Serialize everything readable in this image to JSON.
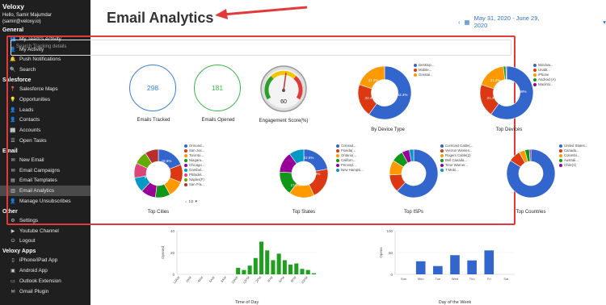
{
  "sidebar": {
    "brand": "Veloxy",
    "greeting": "Hello, Samir Majumdar",
    "email": "(samir@veloxy.io)",
    "sections": [
      {
        "title": "General",
        "items": [
          {
            "label": "My Team's Activity",
            "icon": "team-icon",
            "glyph": "👥"
          },
          {
            "label": "My Activity",
            "icon": "user-icon",
            "glyph": "👤"
          },
          {
            "label": "Push Notifications",
            "icon": "bell-icon",
            "glyph": "🔔"
          },
          {
            "label": "Search",
            "icon": "search-icon",
            "glyph": "🔍"
          }
        ]
      },
      {
        "title": "Salesforce",
        "items": [
          {
            "label": "Salesforce Maps",
            "icon": "map-pin-icon",
            "glyph": "📍"
          },
          {
            "label": "Opportunities",
            "icon": "lightbulb-icon",
            "glyph": "💡"
          },
          {
            "label": "Leads",
            "icon": "user-icon",
            "glyph": "👤"
          },
          {
            "label": "Contacts",
            "icon": "contact-icon",
            "glyph": "👤"
          },
          {
            "label": "Accounts",
            "icon": "building-icon",
            "glyph": "🏢"
          },
          {
            "label": "Open Tasks",
            "icon": "list-icon",
            "glyph": "☰"
          }
        ]
      },
      {
        "title": "Email",
        "items": [
          {
            "label": "New Email",
            "icon": "envelope-icon",
            "glyph": "✉"
          },
          {
            "label": "Email Campaigns",
            "icon": "envelope-icon",
            "glyph": "✉"
          },
          {
            "label": "Email Templates",
            "icon": "template-icon",
            "glyph": "▤"
          },
          {
            "label": "Email Analytics",
            "icon": "bar-chart-icon",
            "glyph": "▥",
            "active": true
          },
          {
            "label": "Manage Unsubscribes",
            "icon": "user-minus-icon",
            "glyph": "👤"
          }
        ]
      },
      {
        "title": "Other",
        "items": [
          {
            "label": "Settings",
            "icon": "gear-icon",
            "glyph": "⚙"
          },
          {
            "label": "Youtube Channel",
            "icon": "video-icon",
            "glyph": "▶"
          },
          {
            "label": "Logout",
            "icon": "logout-icon",
            "glyph": "⏻"
          }
        ]
      },
      {
        "title": "Veloxy Apps",
        "items": [
          {
            "label": "iPhone/iPad App",
            "icon": "phone-icon",
            "glyph": "▯"
          },
          {
            "label": "Android App",
            "icon": "android-icon",
            "glyph": "▣"
          },
          {
            "label": "Outlook Extension",
            "icon": "monitor-icon",
            "glyph": "▭"
          },
          {
            "label": "Gmail Plugin",
            "icon": "gmail-icon",
            "glyph": "✉"
          }
        ]
      }
    ]
  },
  "header": {
    "title": "Email Analytics",
    "date_range": "May 31, 2020 - June 29, 2020"
  },
  "search": {
    "placeholder": "Search Tracking details"
  },
  "metrics": {
    "tracked": {
      "value": "298",
      "label": "Emails Tracked"
    },
    "opened": {
      "value": "181",
      "label": "Emails Opened"
    },
    "engagement": {
      "value": "60",
      "label": "Engagement Score(%)"
    }
  },
  "colors": {
    "blue": "#3366cc",
    "red": "#dc3912",
    "orange": "#ff9900",
    "green": "#109618",
    "purple": "#990099",
    "cyan": "#0099c6",
    "pink": "#dd4477",
    "lime": "#66aa00",
    "darkred": "#b82e2e",
    "navy": "#316395"
  },
  "charts_row1": [
    {
      "caption": "By Device Type",
      "legend": [
        "Desktop...",
        "Mobile...",
        "Greatai..."
      ],
      "labels": [
        "62.4%",
        "22.4%",
        "21.2%"
      ]
    },
    {
      "caption": "Top Devices",
      "legend": [
        "Window...",
        "Unabl...",
        "iPhone",
        "Android (A)",
        "Macinto..."
      ],
      "labels": [
        "69%",
        "21.3%",
        "21.2%"
      ]
    }
  ],
  "charts_row2": [
    {
      "caption": "Top Cities",
      "legend": [
        "Ormond...",
        "San Jos...",
        "Toronto...",
        "Niagara...",
        "Chicago...",
        "Gambel...",
        "Philadel...",
        "Naples(F)",
        "San Fra..."
      ],
      "labels": [
        "18.6%",
        "8%"
      ],
      "pager": "1/2"
    },
    {
      "caption": "Top States",
      "legend": [
        "Colorad...",
        "Florida(...",
        "Ontario(...",
        "Californ...",
        "Pennsyl...",
        "New Hampsi..."
      ],
      "labels": [
        "22.6%",
        "17.3%",
        "21.3%"
      ]
    },
    {
      "caption": "Top ISPs",
      "legend": [
        "Comcast Cable(...",
        "Verizon Wireles...",
        "Rogers Cable(2)",
        "Bell Canada...",
        "Time Warner...",
        "T-Mobi..."
      ],
      "labels": [
        "62.3%"
      ]
    },
    {
      "caption": "Top Countries",
      "legend": [
        "United States...",
        "Canada...",
        "Colombi...",
        "Australi...",
        "Chile(1)"
      ],
      "labels": [
        "84.4%"
      ]
    }
  ],
  "chart_data": [
    {
      "type": "bar",
      "title": "",
      "xlabel": "Time of Day",
      "ylabel": "Opened",
      "ylim": [
        0,
        40
      ],
      "categories": [
        "12AM",
        "1AM",
        "2AM",
        "3AM",
        "4AM",
        "5AM",
        "6AM",
        "7AM",
        "8AM",
        "9AM",
        "10AM",
        "11AM",
        "12PM",
        "1PM",
        "2PM",
        "3PM",
        "4PM",
        "5PM",
        "6PM",
        "7PM",
        "8PM",
        "9PM",
        "10PM",
        "11PM"
      ],
      "values": [
        0,
        0,
        0,
        0,
        0,
        0,
        0,
        0,
        0,
        0,
        6,
        4,
        8,
        15,
        30,
        22,
        13,
        19,
        13,
        9,
        10,
        5,
        4,
        1
      ],
      "tick_labels": [
        "12AM",
        "2AM",
        "4AM",
        "6AM",
        "8AM",
        "10AM",
        "12PM",
        "2PM",
        "4PM",
        "6PM",
        "8PM",
        "10PM"
      ]
    },
    {
      "type": "bar",
      "title": "",
      "xlabel": "Day of the Week",
      "ylabel": "Opens",
      "ylim": [
        0,
        100
      ],
      "categories": [
        "Sun",
        "Mon",
        "Tue",
        "Wed",
        "Thu",
        "Fri",
        "Sat"
      ],
      "values": [
        0,
        30,
        19,
        44,
        32,
        55,
        0
      ],
      "ticks": [
        "0",
        "50",
        "100"
      ]
    }
  ]
}
